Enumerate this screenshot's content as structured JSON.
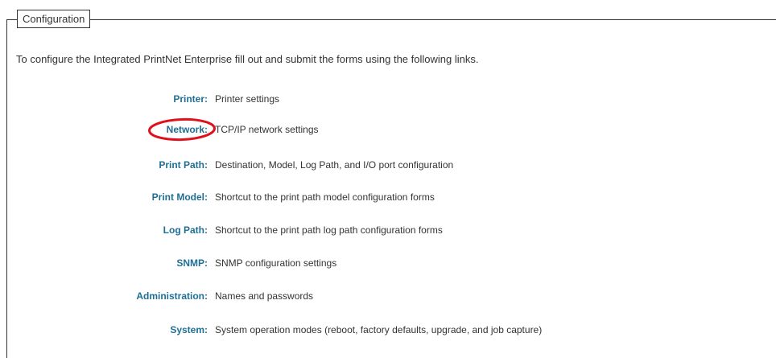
{
  "section": {
    "legend": "Configuration",
    "intro": "To configure the Integrated PrintNet Enterprise fill out and submit the forms using the following links."
  },
  "links": [
    {
      "label": "Printer:",
      "description": "Printer settings"
    },
    {
      "label": "Network:",
      "description": "TCP/IP network settings"
    },
    {
      "label": "Print Path:",
      "description": "Destination, Model, Log Path, and I/O port configuration"
    },
    {
      "label": "Print Model:",
      "description": "Shortcut to the print path model configuration forms"
    },
    {
      "label": "Log Path:",
      "description": "Shortcut to the print path log path configuration forms"
    },
    {
      "label": "SNMP:",
      "description": "SNMP configuration settings"
    },
    {
      "label": "Administration:",
      "description": "Names and passwords"
    },
    {
      "label": "System:",
      "description": "System operation modes (reboot, factory defaults, upgrade, and job capture)"
    }
  ],
  "colors": {
    "link": "#1f6f94",
    "text": "#333333",
    "highlight": "#e0101c"
  },
  "annotation": {
    "highlighted_link": "Network:"
  }
}
